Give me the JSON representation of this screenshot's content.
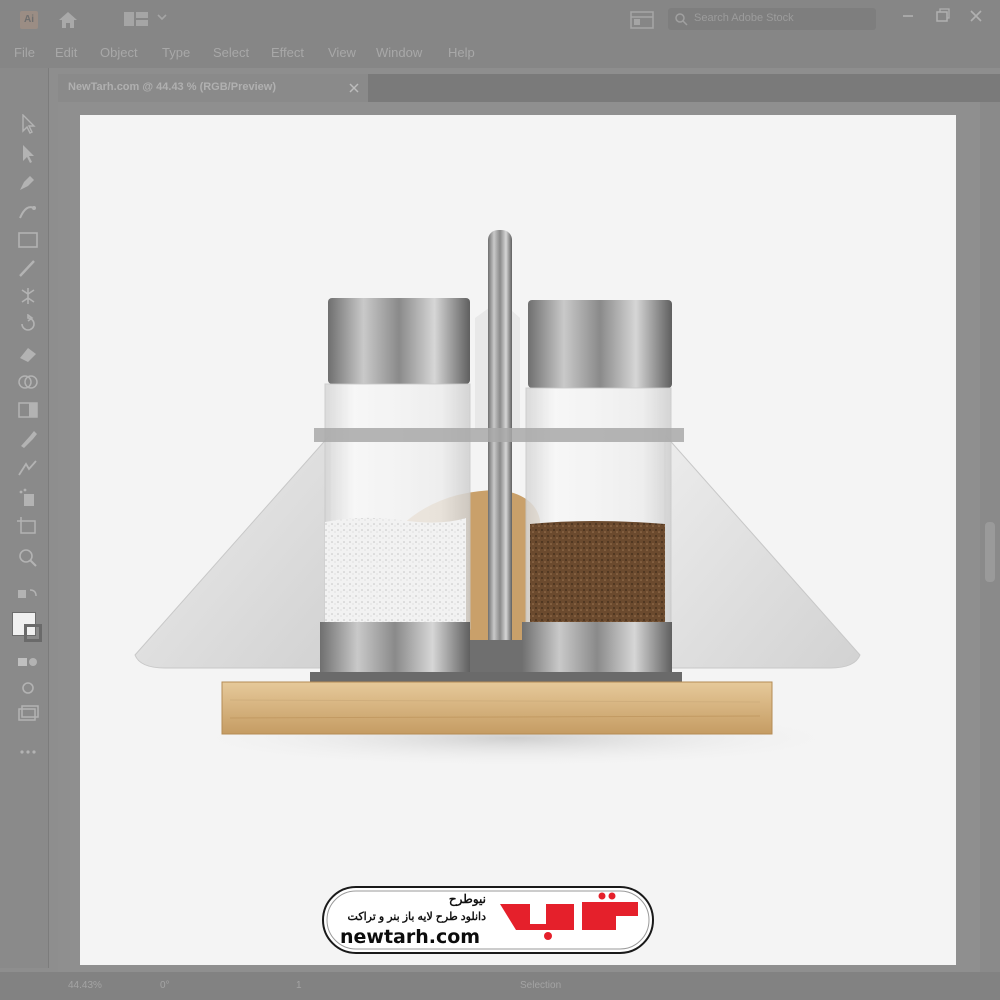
{
  "app": {
    "logo_text": "Ai"
  },
  "search": {
    "placeholder": "Search Adobe Stock"
  },
  "menu": {
    "items": [
      "File",
      "Edit",
      "Object",
      "Type",
      "Select",
      "Effect",
      "View",
      "Window",
      "Help"
    ]
  },
  "document": {
    "tab_title": "NewTarh.com @ 44.43 % (RGB/Preview)"
  },
  "status": {
    "zoom": "44.43%",
    "angle": "0°",
    "artboard": "1",
    "tool": "Selection"
  },
  "badge": {
    "title": "نیوطرح",
    "subtitle": "دانلود طرح لایه باز بنر و تراکت",
    "url": "newtarh.com",
    "logo_text": "نیوطرح",
    "logo_color": "#e5202b"
  },
  "colors": {
    "chrome": "#868686",
    "artboard": "#f4f4f4",
    "wood": "#d9b886",
    "pepper": "#6b4a2e",
    "steel": "#9a9a9a"
  },
  "tools": [
    "selection-tool-icon",
    "direct-selection-tool-icon",
    "pen-tool-icon",
    "curvature-tool-icon",
    "rectangle-tool-icon",
    "paintbrush-tool-icon",
    "width-tool-icon",
    "rotate-tool-icon",
    "eraser-tool-icon",
    "shape-builder-tool-icon",
    "gradient-tool-icon",
    "eyedropper-tool-icon",
    "blend-tool-icon",
    "symbol-sprayer-tool-icon",
    "artboard-tool-icon",
    "zoom-tool-icon"
  ]
}
